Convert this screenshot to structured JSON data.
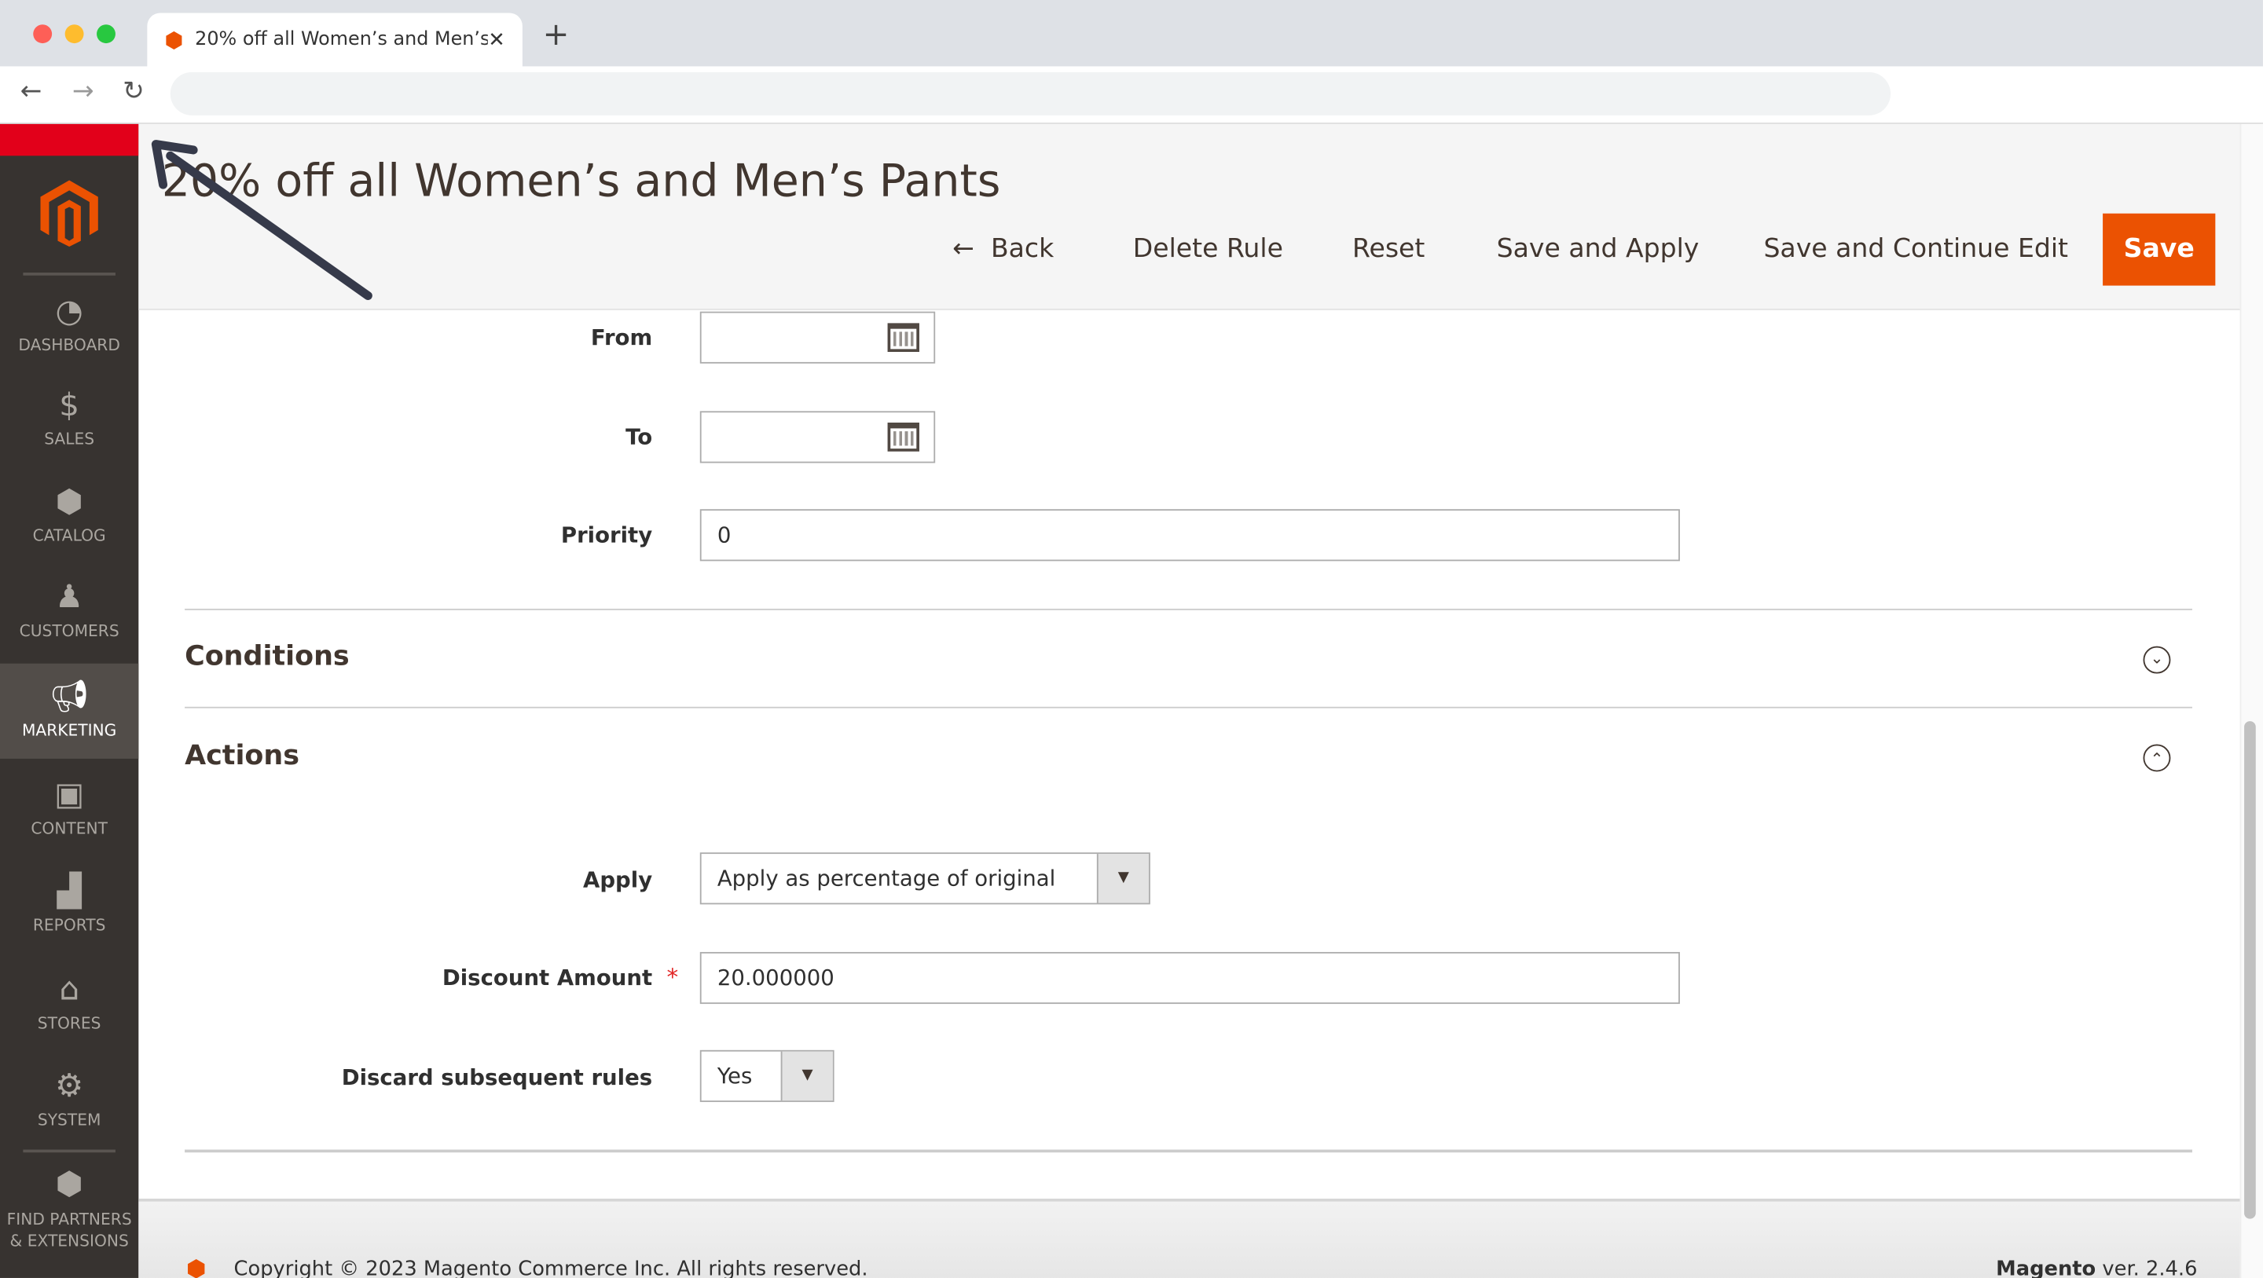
{
  "browser": {
    "tab_title": "20% off all Women’s and Men’s Pants",
    "url": ""
  },
  "sidebar": {
    "items": [
      {
        "label": "DASHBOARD",
        "icon": "dashboard-icon"
      },
      {
        "label": "SALES",
        "icon": "dollar-icon"
      },
      {
        "label": "CATALOG",
        "icon": "box-icon"
      },
      {
        "label": "CUSTOMERS",
        "icon": "person-icon"
      },
      {
        "label": "MARKETING",
        "icon": "megaphone-icon",
        "active": true
      },
      {
        "label": "CONTENT",
        "icon": "layout-icon"
      },
      {
        "label": "REPORTS",
        "icon": "bar-chart-icon"
      },
      {
        "label": "STORES",
        "icon": "store-icon"
      },
      {
        "label": "SYSTEM",
        "icon": "gear-icon"
      },
      {
        "label": "FIND PARTNERS & EXTENSIONS",
        "icon": "partners-icon"
      }
    ]
  },
  "header": {
    "title": "20% off all Women’s and Men’s Pants",
    "back": "Back",
    "delete": "Delete Rule",
    "reset": "Reset",
    "save_apply": "Save and Apply",
    "save_continue": "Save and Continue Edit",
    "save": "Save"
  },
  "form": {
    "from_label": "From",
    "from_value": "",
    "to_label": "To",
    "to_value": "",
    "priority_label": "Priority",
    "priority_value": "0"
  },
  "conditions": {
    "title": "Conditions",
    "expanded": false
  },
  "actions": {
    "title": "Actions",
    "expanded": true,
    "apply_label": "Apply",
    "apply_value": "Apply as percentage of original",
    "discount_label": "Discount Amount",
    "discount_required": "*",
    "discount_value": "20.000000",
    "discard_label": "Discard subsequent rules",
    "discard_value": "Yes"
  },
  "footer": {
    "copyright": "Copyright © 2023 Magento Commerce Inc. All rights reserved.",
    "brand": "Magento",
    "version": "ver. 2.4.6"
  },
  "colors": {
    "accent": "#eb5202",
    "sidebar": "#373330",
    "red_bar": "#e2001a",
    "annotation_arrow": "#363a4a"
  }
}
